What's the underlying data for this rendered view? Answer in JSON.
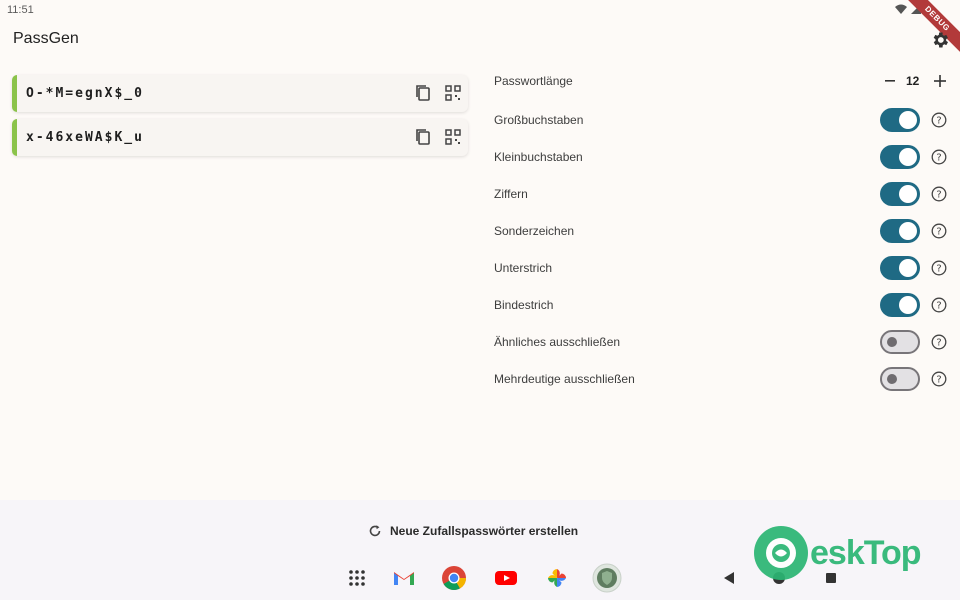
{
  "status": {
    "time": "11:51",
    "debug_label": "DEBUG"
  },
  "app": {
    "title": "PassGen"
  },
  "passwords": [
    {
      "value": "O-*M=egnX$_0"
    },
    {
      "value": "x-46xeWA$K_u"
    }
  ],
  "settings": {
    "length_label": "Passwortlänge",
    "length_value": "12",
    "options": [
      {
        "label": "Großbuchstaben",
        "enabled": true
      },
      {
        "label": "Kleinbuchstaben",
        "enabled": true
      },
      {
        "label": "Ziffern",
        "enabled": true
      },
      {
        "label": "Sonderzeichen",
        "enabled": true
      },
      {
        "label": "Unterstrich",
        "enabled": true
      },
      {
        "label": "Bindestrich",
        "enabled": true
      },
      {
        "label": "Ähnliches ausschließen",
        "enabled": false
      },
      {
        "label": "Mehrdeutige ausschließen",
        "enabled": false
      }
    ]
  },
  "actions": {
    "generate_label": "Neue Zufallspasswörter erstellen"
  },
  "watermark": {
    "text": "eskTop"
  },
  "colors": {
    "accent": "#1f6a84",
    "card_accent": "#8bc34a"
  },
  "taskbar": [
    "apps-grid-icon",
    "gmail-icon",
    "chrome-icon",
    "youtube-icon",
    "photos-icon",
    "passgen-app-icon"
  ]
}
